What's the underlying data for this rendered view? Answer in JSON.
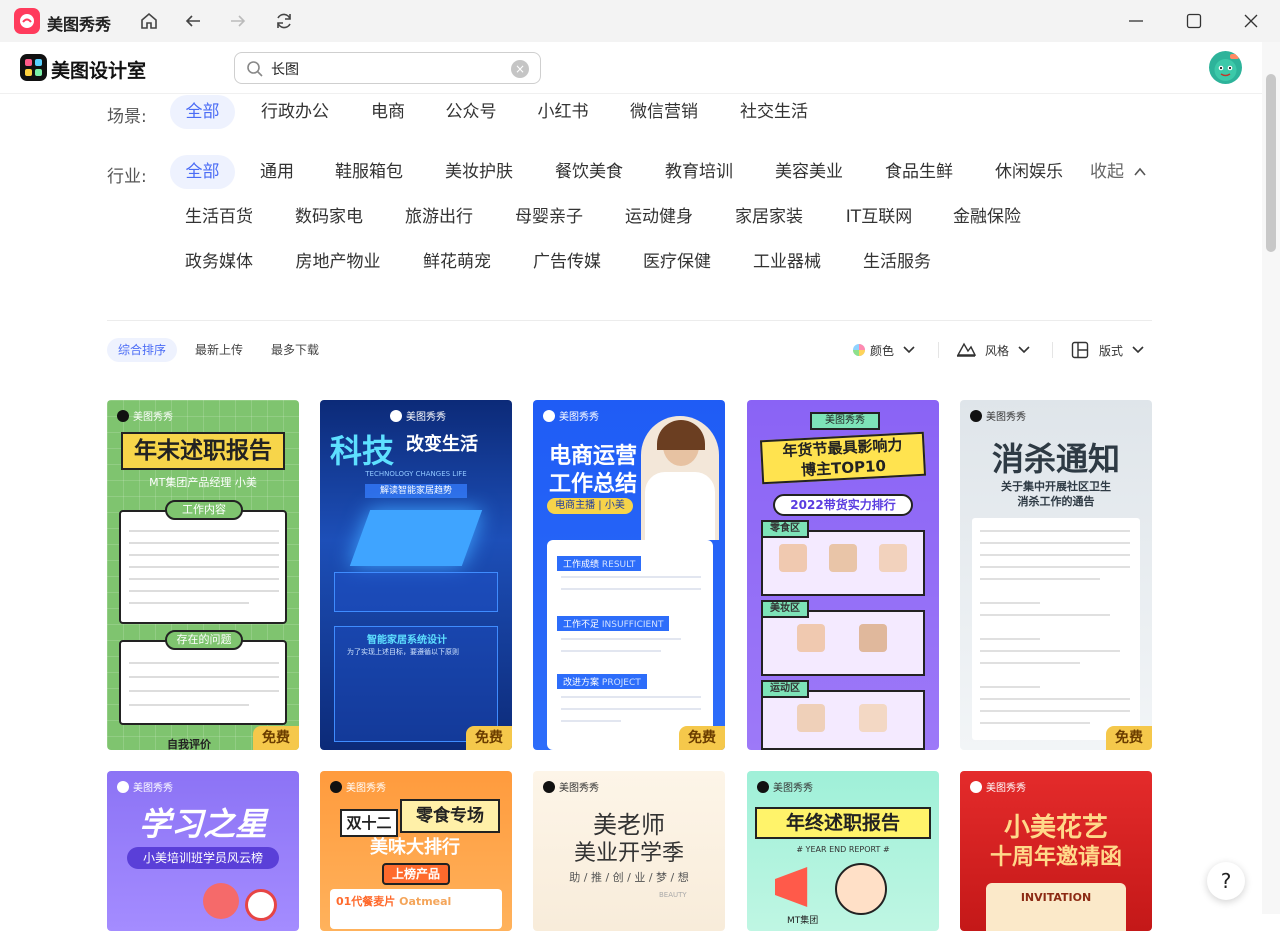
{
  "app": {
    "title": "美图秀秀"
  },
  "header": {
    "brand": "美图设计室",
    "search": {
      "value": "长图",
      "placeholder": ""
    }
  },
  "scene": {
    "label": "场景:",
    "items": [
      "全部",
      "行政办公",
      "电商",
      "公众号",
      "小红书",
      "微信营销",
      "社交生活"
    ]
  },
  "industry": {
    "label": "行业:",
    "collapse": "收起",
    "items": [
      "全部",
      "通用",
      "鞋服箱包",
      "美妆护肤",
      "餐饮美食",
      "教育培训",
      "美容美业",
      "食品生鲜",
      "休闲娱乐",
      "生活百货",
      "数码家电",
      "旅游出行",
      "母婴亲子",
      "运动健身",
      "家居家装",
      "IT互联网",
      "金融保险",
      "政务媒体",
      "房地产物业",
      "鲜花萌宠",
      "广告传媒",
      "医疗保健",
      "工业器械",
      "生活服务"
    ]
  },
  "sort": {
    "items": [
      "综合排序",
      "最新上传",
      "最多下载"
    ]
  },
  "filters": {
    "color": "颜色",
    "style": "风格",
    "layout": "版式"
  },
  "watermark": "美图秀秀",
  "badge_free": "免费",
  "cards": [
    {
      "title": "年末述职报告",
      "subtitle": "MT集团产品经理 小美",
      "h1": "工作内容",
      "h2": "存在的问题",
      "h3": "自我评价",
      "free": true
    },
    {
      "title": "科技",
      "title2": "改变生活",
      "subtitle": "TECHNOLOGY CHANGES LIFE",
      "tag": "解读智能家居趋势",
      "h1": "智能家居系统设计",
      "h2": "为了实现上述目标，要遵循以下原则",
      "free": true
    },
    {
      "title": "电商运营",
      "title2": "工作总结",
      "subtitle": "电商主播 | 小美",
      "h1": "工作成绩",
      "h1en": "RESULT",
      "h2": "工作不足",
      "h2en": "INSUFFICIENT",
      "h3": "改进方案",
      "h3en": "PROJECT",
      "free": true
    },
    {
      "title": "年货节最具影响力",
      "title2": "博主TOP10",
      "subtitle": "2022带货实力排行",
      "h1": "零食区",
      "h2": "美妆区",
      "h3": "运动区",
      "free": false
    },
    {
      "title": "消杀通知",
      "subtitle": "关于集中开展社区卫生",
      "subtitle2": "消杀工作的通告",
      "free": true
    },
    {
      "title": "学习之星",
      "subtitle": "小美培训班学员风云榜"
    },
    {
      "title": "双十二",
      "title2": "零食专场",
      "title3": "美味大排行",
      "tag": "上榜产品",
      "item": "01代餐麦片",
      "item_en": "Oatmeal"
    },
    {
      "title": "美老师",
      "title2": "美业开学季",
      "subtitle": "助 / 推 / 创 / 业 / 梦 / 想",
      "small": "BEAUTY"
    },
    {
      "title": "年终述职报告",
      "subtitle": "# YEAR END REPORT #",
      "small": "MT集团"
    },
    {
      "title": "小美花艺",
      "title2": "十周年邀请函",
      "subtitle": "INVITATION"
    }
  ],
  "help": "?"
}
